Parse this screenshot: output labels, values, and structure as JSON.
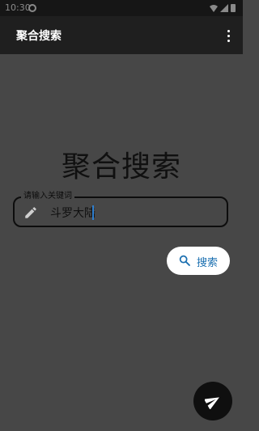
{
  "status_bar": {
    "time": "10:30",
    "icons": [
      "settings-icon",
      "wifi-icon",
      "signal-icon",
      "battery-icon"
    ]
  },
  "app_bar": {
    "title": "聚合搜索",
    "menu_icon": "more-vertical-icon"
  },
  "main": {
    "heading": "聚合搜索",
    "search_field": {
      "label": "请输入关键词",
      "value": "斗罗大陆",
      "icon": "edit-icon"
    },
    "search_button": {
      "label": "搜索",
      "icon": "search-icon"
    }
  },
  "fab": {
    "icon": "send-icon"
  },
  "colors": {
    "background": "#474747",
    "app_bar": "#1f1f1f",
    "status_bar": "#161616",
    "accent": "#1a6fb0",
    "button_bg": "#ffffff",
    "fab_bg": "#0f0f0f"
  }
}
